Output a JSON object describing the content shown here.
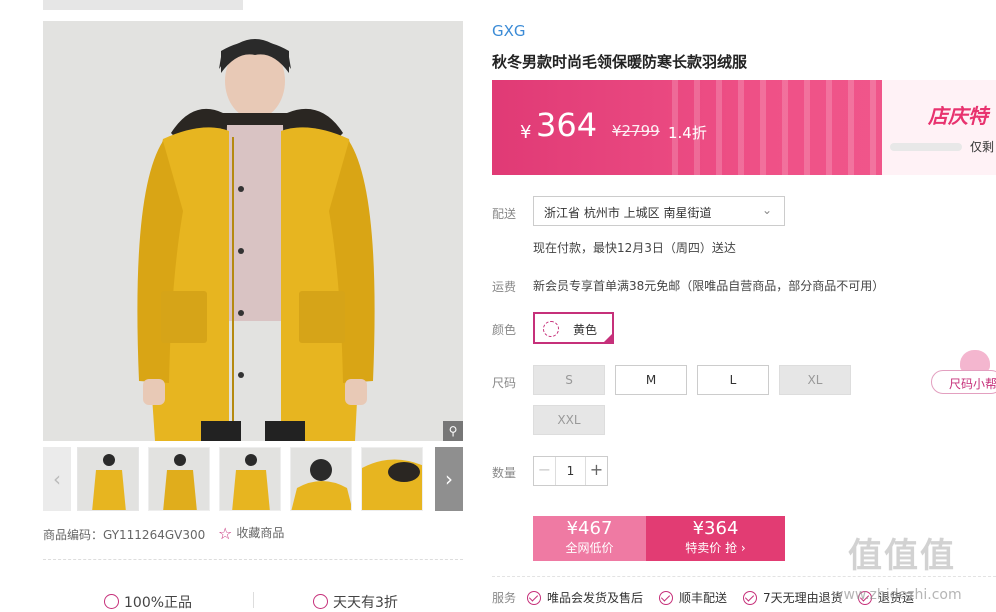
{
  "product": {
    "brand": "GXG",
    "title": "秋冬男款时尚毛领保暖防寒长款羽绒服",
    "code_label": "商品编码：GY111264GV300",
    "favorite_label": "收藏商品"
  },
  "price": {
    "currency": "¥",
    "current": "364",
    "original": "¥2799",
    "discount": "1.4折",
    "promo_text": "店庆特",
    "promo_note": "仅剩"
  },
  "delivery": {
    "label": "配送",
    "address": "浙江省 杭州市 上城区 南星街道",
    "note": "现在付款，最快12月3日（周四）送达"
  },
  "freight": {
    "label": "运费",
    "text": "新会员专享首单满38元免邮（限唯品自营商品，部分商品不可用）"
  },
  "color": {
    "label": "颜色",
    "selected": "黄色"
  },
  "size": {
    "label": "尺码",
    "help_label": "尺码小帮",
    "options": [
      {
        "label": "S",
        "available": false
      },
      {
        "label": "M",
        "available": true
      },
      {
        "label": "L",
        "available": true
      },
      {
        "label": "XL",
        "available": false
      },
      {
        "label": "XXL",
        "available": false
      }
    ]
  },
  "quantity": {
    "label": "数量",
    "minus": "−",
    "value": "1",
    "plus": "+"
  },
  "buy": {
    "left_price": "¥467",
    "left_label": "全网低价",
    "right_price": "¥364",
    "right_label": "特卖价 抢 ›"
  },
  "guarantees": {
    "authentic": "100%正品",
    "daily_discount": "天天有3折"
  },
  "services": {
    "label": "服务",
    "items": [
      "唯品会发货及售后",
      "顺丰配送",
      "7天无理由退货",
      "退货运"
    ]
  },
  "gallery": {
    "zoom_icon": "magnifier-icon",
    "prev_glyph": "‹",
    "next_glyph": "›"
  },
  "watermark": {
    "logo": "值值值",
    "url": "www.zhidezhi.com"
  },
  "colors": {
    "accent": "#e23c73",
    "brand_blue": "#3b8bd6",
    "jacket_yellow": "#e7b520"
  }
}
